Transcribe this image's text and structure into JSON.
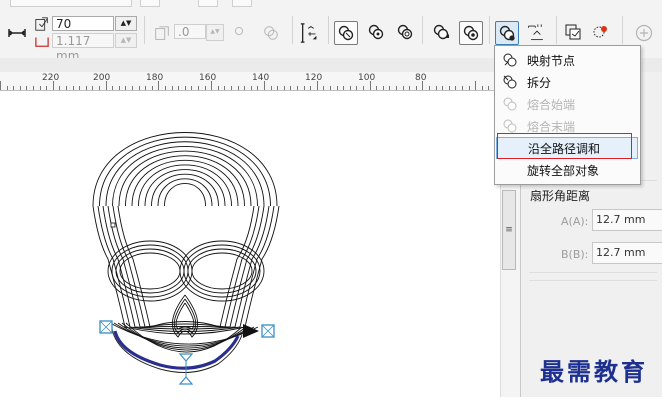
{
  "toolbar": {
    "steps_value": "70",
    "spacing_value": "1.117 mm",
    "offset_value": ".0",
    "icons": [
      "blend-direction-icon",
      "path-properties-icon",
      "more-blend-options-icon"
    ]
  },
  "ruler": {
    "labels": [
      "220",
      "200",
      "180",
      "160",
      "140",
      "120",
      "100",
      "80"
    ]
  },
  "menu": {
    "items": [
      {
        "label": "映射节点",
        "icon": "map-nodes-icon",
        "enabled": true,
        "highlight": false
      },
      {
        "label": "拆分",
        "icon": "split-icon",
        "enabled": true,
        "highlight": false
      },
      {
        "label": "熔合始端",
        "icon": "fuse-start-icon",
        "enabled": false,
        "highlight": false
      },
      {
        "label": "熔合末端",
        "icon": "fuse-end-icon",
        "enabled": false,
        "highlight": false
      },
      {
        "label": "沿全路径调和",
        "icon": "",
        "enabled": true,
        "highlight": true
      },
      {
        "label": "旋转全部对象",
        "icon": "",
        "enabled": true,
        "highlight": false
      }
    ]
  },
  "docker": {
    "section_title": "扇形角距离",
    "a_label": "A(A):",
    "a_value": "12.7 mm",
    "b_label": "B(B):",
    "b_value": "12.7 mm"
  },
  "watermark": "最需教育",
  "colors": {
    "highlight_border": "#e01b24",
    "selection": "#e5f0fb",
    "blend_path": "#2a2f8f",
    "watermark": "#1d2f8f"
  }
}
